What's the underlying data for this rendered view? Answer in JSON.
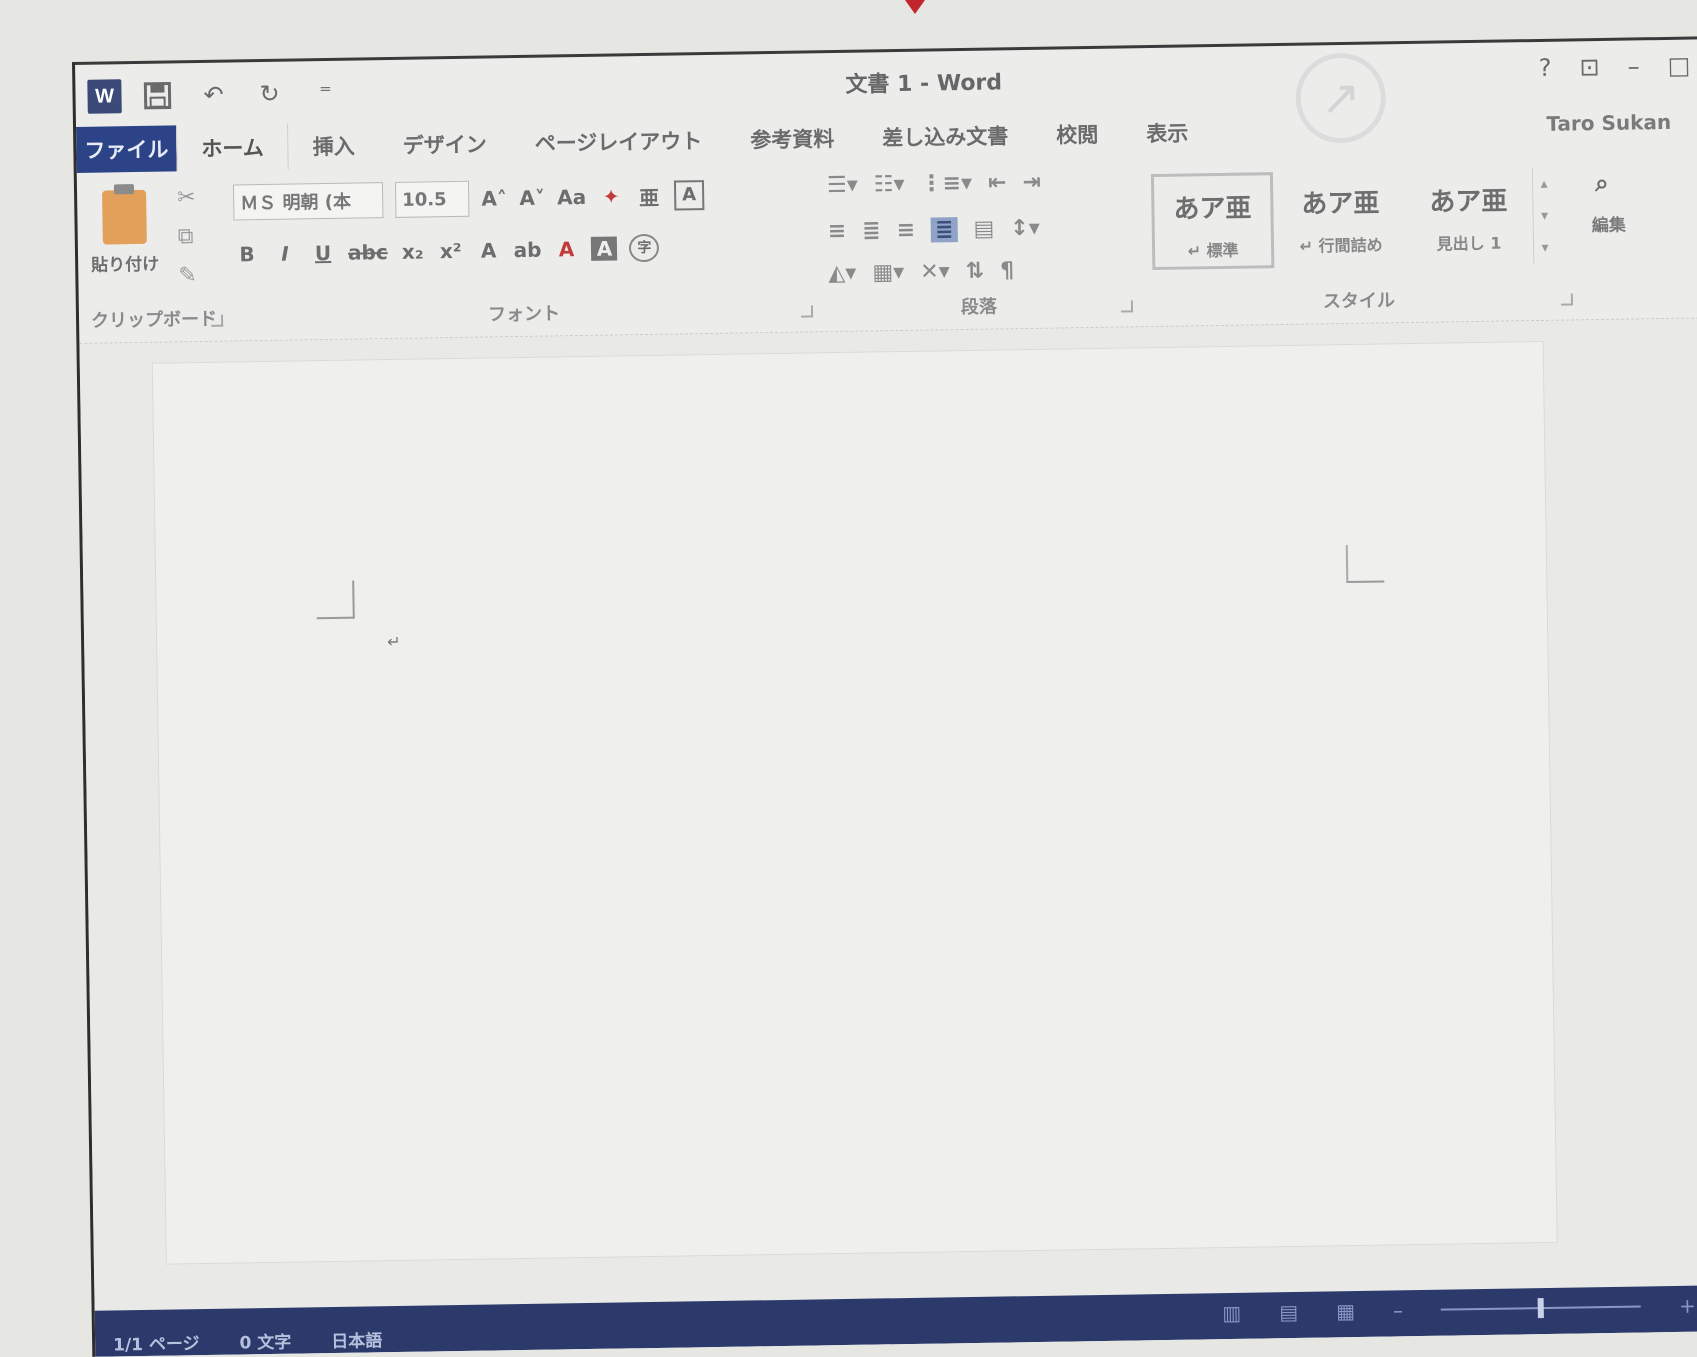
{
  "window": {
    "title": "文書 1 - Word",
    "user": "Taro Sukan",
    "controls": {
      "help": "?",
      "ribbon_options": "⊡",
      "minimize": "–",
      "maximize": "□"
    }
  },
  "quick_access": {
    "app_icon": "W",
    "save_icon": "save-icon",
    "undo_icon": "undo-icon",
    "redo_icon": "redo-icon",
    "customize": "⁼"
  },
  "tabs": [
    "ファイル",
    "ホーム",
    "挿入",
    "デザイン",
    "ページレイアウト",
    "参考資料",
    "差し込み文書",
    "校閲",
    "表示"
  ],
  "active_tab": "ホーム",
  "ribbon": {
    "clipboard": {
      "label": "クリップボード",
      "paste": "貼り付け"
    },
    "font": {
      "label": "フォント",
      "font_name": "ＭＳ 明朝 (本",
      "font_size": "10.5",
      "grow": "A˄",
      "shrink": "A˅",
      "change_case": "Aa",
      "clear_format": "✦",
      "phonetic": "亜",
      "char_border": "A",
      "bold": "B",
      "italic": "I",
      "underline": "U",
      "strike": "abc",
      "subscript": "x₂",
      "superscript": "x²",
      "text_effects": "A",
      "highlight": "ab",
      "font_color": "A",
      "char_shading": "A",
      "enclosed": "字"
    },
    "paragraph": {
      "label": "段落"
    },
    "styles": {
      "label": "スタイル",
      "items": [
        {
          "sample": "あア亜",
          "name": "↵ 標準"
        },
        {
          "sample": "あア亜",
          "name": "↵ 行間詰め"
        },
        {
          "sample": "あア亜",
          "name": "見出し 1"
        }
      ]
    },
    "editing": {
      "label": "編集",
      "icon": "find-icon"
    }
  },
  "status": {
    "page": "1/1 ページ",
    "words": "0 文字",
    "language": "日本語"
  },
  "colors": {
    "file_tab": "#2c4487",
    "status_bar": "#2b3a6b",
    "accent_red": "#c0262c"
  }
}
